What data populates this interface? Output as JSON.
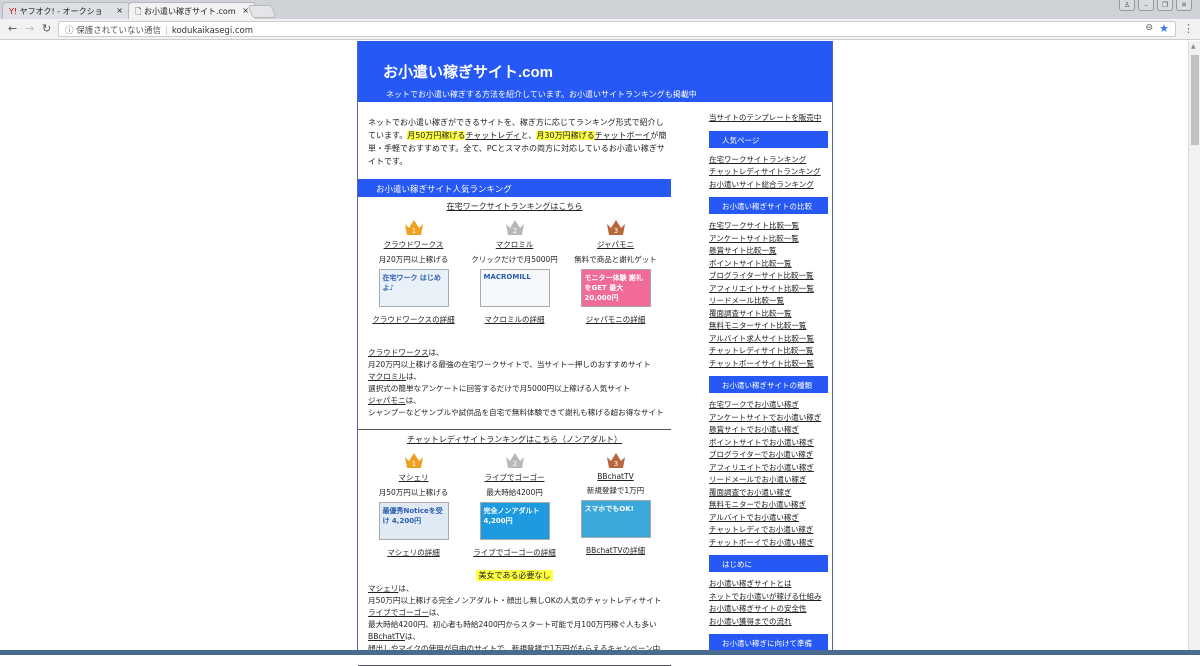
{
  "browser": {
    "tabs": [
      {
        "title": "ヤフオク! - オークショ",
        "close": "×"
      },
      {
        "title": "お小遣い稼ぎサイト.com",
        "close": "×"
      }
    ],
    "security_label": "保護されていない通信",
    "url": "kodukaikasegi.com"
  },
  "site": {
    "title": "お小遣い稼ぎサイト.com",
    "tagline": "ネットでお小遣い稼ぎする方法を紹介しています。お小遣いサイトランキングも掲載中"
  },
  "intro": {
    "p1": "ネットでお小遣い稼ぎができるサイトを、稼ぎ方に応じてランキング形式で紹介しています。",
    "hl1": "月50万円稼げる",
    "link1": "チャットレディ",
    "mid": "と、",
    "hl2": "月30万円稼げる",
    "link2": "チャットボーイ",
    "p2": "が簡単・手軽でおすすめです。全て、PCとスマホの両方に対応しているお小遣い稼ぎサイトです。"
  },
  "ranking": {
    "heading": "お小遣い稼ぎサイト人気ランキング",
    "work": {
      "link": "在宅ワークサイトランキングはこちら",
      "items": [
        {
          "rank": "1",
          "name": "クラウドワークス",
          "desc": "月20万円以上稼げる",
          "banner": "在宅ワーク はじめよ♪",
          "detail": "クラウドワークスの詳細"
        },
        {
          "rank": "2",
          "name": "マクロミル",
          "desc": "クリックだけで月5000円",
          "banner": "MACROMILL",
          "detail": "マクロミルの詳細"
        },
        {
          "rank": "3",
          "name": "ジャパモニ",
          "desc": "無料で商品と謝礼ゲット",
          "banner": "モニター体験 謝礼をGET 最大20,000円",
          "detail": "ジャパモニの詳細"
        }
      ],
      "descs": [
        {
          "name": "クラウドワークス",
          "suffix": "は、",
          "text": "月20万円以上稼げる最強の在宅ワークサイトで、当サイト一押しのおすすめサイト"
        },
        {
          "name": "マクロミル",
          "suffix": "は、",
          "text": "選択式の簡単なアンケートに回答するだけで月5000円以上稼げる人気サイト"
        },
        {
          "name": "ジャパモニ",
          "suffix": "は、",
          "text": "シャンプーなどサンプルや試供品を自宅で無料体験できて謝礼も稼げる超お得なサイト"
        }
      ]
    },
    "chat": {
      "link": "チャットレディサイトランキングはこちら（ノンアダルト）",
      "items": [
        {
          "rank": "1",
          "name": "マシェリ",
          "desc": "月50万円以上稼げる",
          "banner": "最優秀Noticeを受け 4,200円",
          "detail": "マシェリの詳細"
        },
        {
          "rank": "2",
          "name": "ライブでゴーゴー",
          "desc": "最大時給4200円",
          "banner": "完全ノンアダルト 4,200円",
          "detail": "ライブでゴーゴーの詳細"
        },
        {
          "rank": "3",
          "name": "BBchatTV",
          "desc": "新規登録で1万円",
          "banner": "スマホでもOK!",
          "detail": "BBchatTVの詳細"
        }
      ],
      "highlight": "美女である必要なし",
      "descs": [
        {
          "name": "マシェリ",
          "suffix": "は、",
          "text": "月50万円以上稼げる完全ノンアダルト・顔出し無しOKの人気のチャットレディサイト"
        },
        {
          "name": "ライブでゴーゴー",
          "suffix": "は、",
          "text": "最大時給4200円、初心者も時給2400円からスタート可能で月100万円稼ぐ人も多い"
        },
        {
          "name": "BBchatTV",
          "suffix": "は、",
          "text": "顔出しやマイクの使用が自由のサイトで、新規登録で1万円がもらえるキャンペーン中"
        }
      ]
    }
  },
  "sidebar": {
    "top_link": "当サイトのテンプレートを販売中",
    "sections": [
      {
        "heading": "人気ページ",
        "items": [
          "在宅ワークサイトランキング",
          "チャットレディサイトランキング",
          "お小遣いサイト総合ランキング"
        ]
      },
      {
        "heading": "お小遣い稼ぎサイトの比較",
        "items": [
          "在宅ワークサイト比較一覧",
          "アンケートサイト比較一覧",
          "懸賞サイト比較一覧",
          "ポイントサイト比較一覧",
          "ブログライターサイト比較一覧",
          "アフィリエイトサイト比較一覧",
          "リードメール比較一覧",
          "覆面調査サイト比較一覧",
          "無料モニターサイト比較一覧",
          "アルバイト求人サイト比較一覧",
          "チャットレディサイト比較一覧",
          "チャットボーイサイト比較一覧"
        ]
      },
      {
        "heading": "お小遣い稼ぎサイトの種類",
        "items": [
          "在宅ワークでお小遣い稼ぎ",
          "アンケートサイトでお小遣い稼ぎ",
          "懸賞サイトでお小遣い稼ぎ",
          "ポイントサイトでお小遣い稼ぎ",
          "ブログライターでお小遣い稼ぎ",
          "アフィリエイトでお小遣い稼ぎ",
          "リードメールでお小遣い稼ぎ",
          "覆面調査でお小遣い稼ぎ",
          "無料モニターでお小遣い稼ぎ",
          "アルバイトでお小遣い稼ぎ",
          "チャットレディでお小遣い稼ぎ",
          "チャットボーイでお小遣い稼ぎ"
        ]
      },
      {
        "heading": "はじめに",
        "items": [
          "お小遣い稼ぎサイトとは",
          "ネットでお小遣いが稼げる仕組み",
          "お小遣い稼ぎサイトの安全性",
          "お小遣い獲得までの流れ"
        ]
      },
      {
        "heading": "お小遣い稼ぎに向けて準備",
        "items": []
      }
    ]
  },
  "colors": {
    "brand": "#2558f5",
    "highlight": "#ffff44",
    "gold": "#f0a020",
    "silver": "#b8b8b8",
    "bronze": "#b8673a"
  }
}
